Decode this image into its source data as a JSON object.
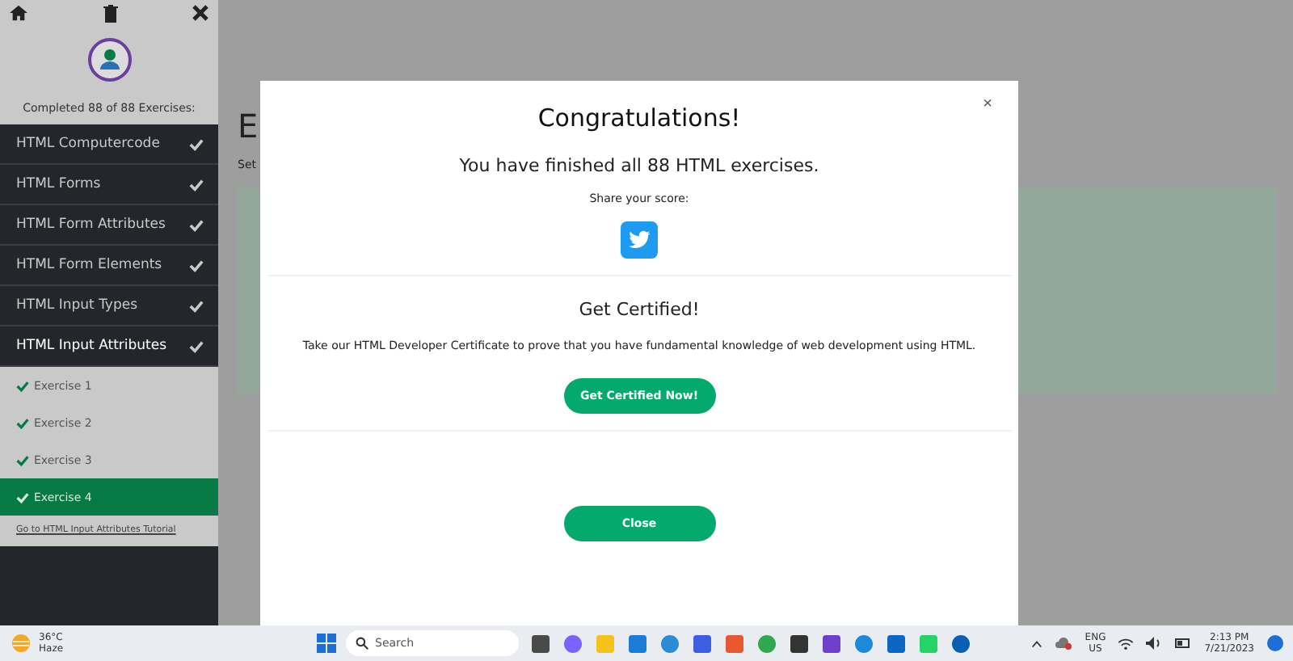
{
  "sidebar": {
    "progress": "Completed 88 of 88 Exercises:",
    "topics": [
      {
        "label": "HTML Computercode",
        "completed": true,
        "expanded": false
      },
      {
        "label": "HTML Forms",
        "completed": true,
        "expanded": false
      },
      {
        "label": "HTML Form Attributes",
        "completed": true,
        "expanded": false
      },
      {
        "label": "HTML Form Elements",
        "completed": true,
        "expanded": false
      },
      {
        "label": "HTML Input Types",
        "completed": true,
        "expanded": false
      },
      {
        "label": "HTML Input Attributes",
        "completed": true,
        "expanded": true
      }
    ],
    "exercises": [
      {
        "label": "Exercise 1",
        "completed": true,
        "selected": false
      },
      {
        "label": "Exercise 2",
        "completed": true,
        "selected": false
      },
      {
        "label": "Exercise 3",
        "completed": true,
        "selected": false
      },
      {
        "label": "Exercise 4",
        "completed": true,
        "selected": true
      }
    ],
    "tutorial_link": "Go to HTML Input Attributes Tutorial"
  },
  "page": {
    "heading": "E",
    "text": "Set"
  },
  "modal": {
    "title": "Congratulations!",
    "message": "You have finished all 88 HTML exercises.",
    "share_label": "Share your score:",
    "cert_title": "Get Certified!",
    "cert_text": "Take our HTML Developer Certificate to prove that you have fundamental knowledge of web development using HTML.",
    "cert_button": "Get Certified Now!",
    "close_symbol": "×",
    "close_button": "Close"
  },
  "taskbar": {
    "temperature": "36°C",
    "weather": "Haze",
    "search_placeholder": "Search",
    "language": "ENG",
    "region": "US",
    "time": "2:13 PM",
    "date": "7/21/2023"
  }
}
